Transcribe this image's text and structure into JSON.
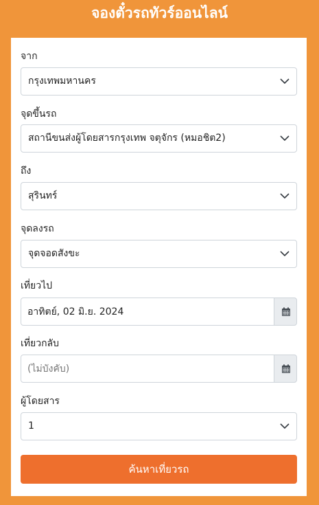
{
  "header": {
    "title": "จองตั๋วรถทัวร์ออนไลน์"
  },
  "form": {
    "from": {
      "label": "จาก",
      "value": "กรุงเทพมหานคร"
    },
    "pickup": {
      "label": "จุดขึ้นรถ",
      "value": "สถานีขนส่งผู้โดยสารกรุงเทพ จตุจักร (หมอชิต2)"
    },
    "to": {
      "label": "ถึง",
      "value": "สุรินทร์"
    },
    "dropoff": {
      "label": "จุดลงรถ",
      "value": "จุดจอดสังขะ"
    },
    "depart": {
      "label": "เที่ยวไป",
      "value": "อาทิตย์, 02 มิ.ย. 2024"
    },
    "return": {
      "label": "เที่ยวกลับ",
      "placeholder": "(ไม่บังคับ)"
    },
    "passengers": {
      "label": "ผู้โดยสาร",
      "value": "1"
    },
    "search_label": "ค้นหาเที่ยวรถ"
  },
  "colors": {
    "background": "#f0953a",
    "button": "#ee6f2d",
    "card": "#ffffff",
    "addon": "#e9ecef"
  }
}
